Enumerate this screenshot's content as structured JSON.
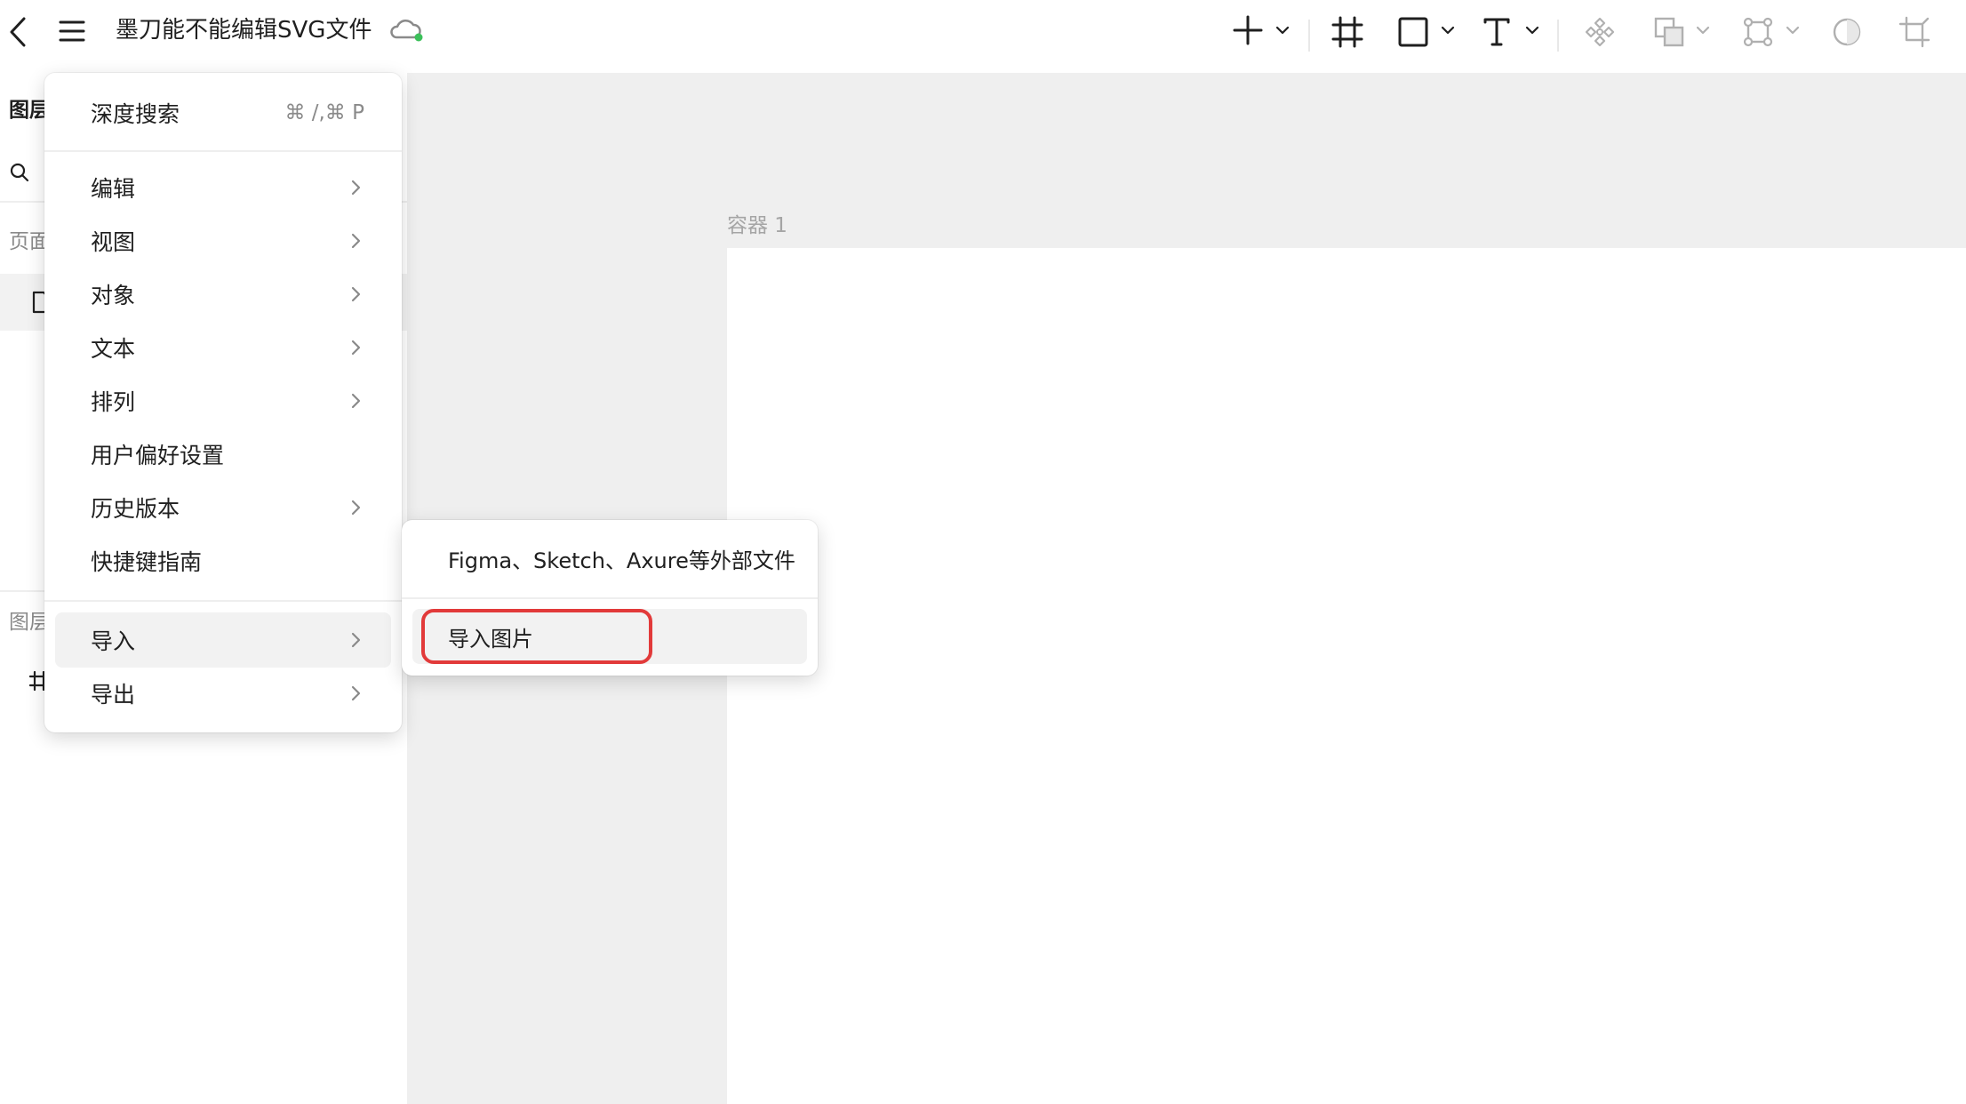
{
  "topbar": {
    "doc_title": "墨刀能不能编辑SVG文件",
    "sync_status_color": "#3cc05a",
    "tools": [
      "add-icon",
      "frame-icon",
      "rectangle-icon",
      "text-icon",
      "component-icon",
      "boolean-icon",
      "vector-icon",
      "ellipse-icon",
      "crop-icon"
    ]
  },
  "leftpanel": {
    "layers_tab": "图层",
    "pages_label": "页面",
    "layers_label": "图层"
  },
  "canvas": {
    "frame_label": "容器 1"
  },
  "menu": {
    "items": [
      {
        "label": "深度搜索",
        "shortcut": "⌘ /,⌘ P"
      },
      {
        "label": "编辑",
        "submenu": true
      },
      {
        "label": "视图",
        "submenu": true
      },
      {
        "label": "对象",
        "submenu": true
      },
      {
        "label": "文本",
        "submenu": true
      },
      {
        "label": "排列",
        "submenu": true
      },
      {
        "label": "用户偏好设置",
        "submenu": false
      },
      {
        "label": "历史版本",
        "submenu": true
      },
      {
        "label": "快捷键指南",
        "submenu": false
      },
      {
        "label": "导入",
        "submenu": true,
        "active": true
      },
      {
        "label": "导出",
        "submenu": true
      }
    ]
  },
  "submenu": {
    "items": [
      {
        "label": "Figma、Sketch、Axure等外部文件"
      },
      {
        "label": "导入图片",
        "highlighted": true
      }
    ],
    "highlight_color": "#e23a3a"
  }
}
